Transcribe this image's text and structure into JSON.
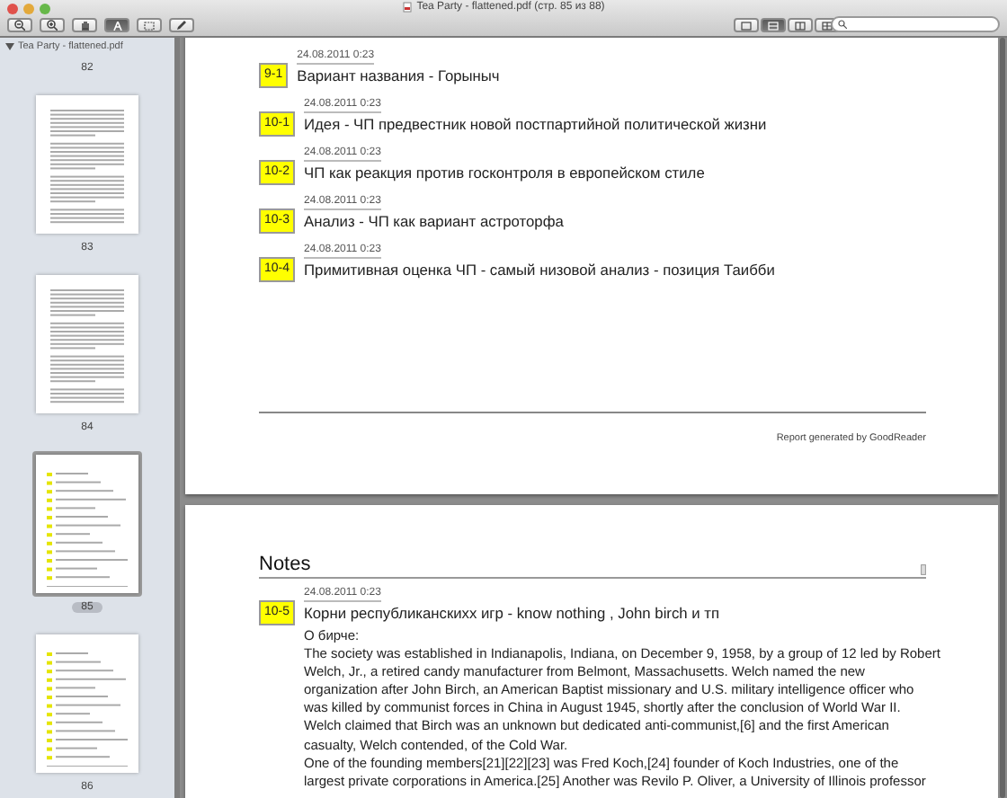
{
  "window": {
    "title": "Tea Party - flattened.pdf (стр. 85 из 88)"
  },
  "toolbar": {
    "tools": [
      {
        "kind": "zoom-out",
        "selected": false
      },
      {
        "kind": "zoom-in",
        "selected": false
      },
      {
        "kind": "hand",
        "selected": false
      },
      {
        "kind": "text",
        "selected": true
      },
      {
        "kind": "rect",
        "selected": false
      },
      {
        "kind": "pencil",
        "selected": false
      }
    ],
    "views": [
      {
        "kind": "single",
        "selected": false
      },
      {
        "kind": "continuous",
        "selected": true
      },
      {
        "kind": "two-up",
        "selected": false
      },
      {
        "kind": "two-up-continuous",
        "selected": false
      }
    ]
  },
  "sidebar": {
    "document": "Tea Party - flattened.pdf",
    "expanded": true,
    "pages": [
      {
        "label": "82",
        "kind": "none",
        "selected": false
      },
      {
        "label": "83",
        "kind": "text",
        "selected": false
      },
      {
        "label": "84",
        "kind": "text",
        "selected": false
      },
      {
        "label": "85",
        "kind": "notes",
        "selected": true
      },
      {
        "label": "86",
        "kind": "notes",
        "selected": false
      }
    ]
  },
  "pages": [
    {
      "notes": [
        {
          "badge": "9-1",
          "date": "24.08.2011 0:23",
          "title": "Вариант названия - Горыныч"
        },
        {
          "badge": "10-1",
          "date": "24.08.2011 0:23",
          "title": "Идея - ЧП предвестник новой постпартийной политической жизни"
        },
        {
          "badge": "10-2",
          "date": "24.08.2011 0:23",
          "title": "ЧП как реакция против  госконтроля в европейском стиле"
        },
        {
          "badge": "10-3",
          "date": "24.08.2011 0:23",
          "title": "Анализ - ЧП как вариант астроторфа"
        },
        {
          "badge": "10-4",
          "date": "24.08.2011 0:23",
          "title": "Примитивная оценка ЧП - самый низовой анализ - позиция Таибби"
        }
      ],
      "footer": "Report generated by GoodReader"
    },
    {
      "heading": "Notes",
      "notes": [
        {
          "badge": "10-5",
          "date": "24.08.2011 0:23",
          "title": "Корни республиканскихх игр - know nothing , John birch и тп",
          "body": [
            "О бирче:",
            "The society was established in Indianapolis, Indiana, on December 9, 1958, by a group of 12 led by Robert Welch, Jr., a retired candy manufacturer from Belmont, Massachusetts. Welch named the new organization after John Birch, an American Baptist missionary and U.S. military intelligence officer who was killed by communist forces in China in August 1945, shortly after the conclusion of World War II. Welch claimed that Birch was an unknown but dedicated anti-communist,[6] and the first American casualty, Welch contended, of the Cold War.",
            "One of the founding members[21][22][23] was Fred Koch,[24] founder of Koch Industries, one of the largest private corporations in America.[25] Another was Revilo P. Oliver, a University of Illinois professor"
          ]
        }
      ]
    }
  ]
}
